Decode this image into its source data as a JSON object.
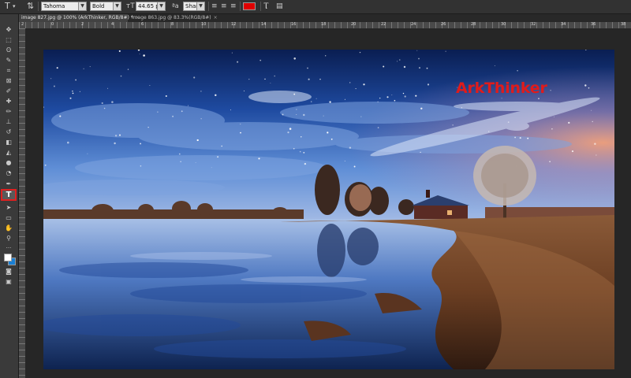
{
  "options_bar": {
    "font_family": "Tahoma",
    "font_style": "Bold",
    "font_size": "44.65 pt",
    "antialias": "Sharp",
    "text_color": "#e00000"
  },
  "tabs": [
    {
      "label": "image 827.jpg @ 100% (ArkThinker, RGB/8#) *",
      "close": "×"
    },
    {
      "label": "image 863.jpg @ 83.3%(RGB/8#)",
      "close": "×"
    }
  ],
  "ruler": {
    "labels": [
      "2",
      "0",
      "2",
      "4",
      "6",
      "8",
      "10",
      "12",
      "14",
      "16",
      "18",
      "20",
      "22",
      "24",
      "26",
      "28",
      "30",
      "32",
      "34",
      "36",
      "38"
    ]
  },
  "canvas": {
    "text_layer": "ArkThinker"
  },
  "colors": {
    "foreground": "#ffffff",
    "background": "#1a7fd4",
    "selection_highlight": "#e02020"
  },
  "toolbar": {
    "selected_tool": "type-tool"
  }
}
